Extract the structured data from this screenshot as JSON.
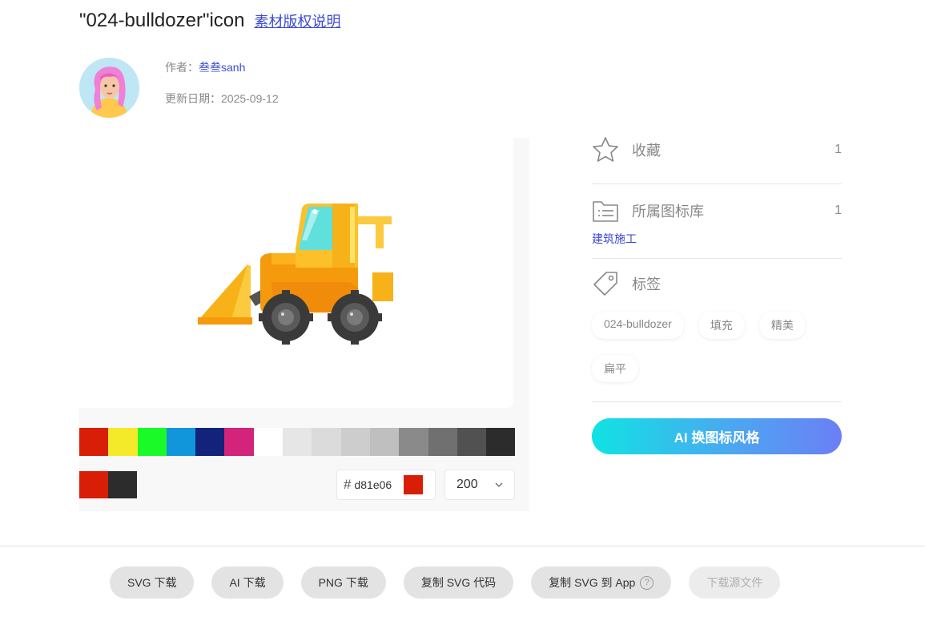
{
  "header": {
    "title": "\"024-bulldozer\"icon",
    "copyright_link": "素材版权说明"
  },
  "author": {
    "label": "作者：",
    "name": "叁叁sanh",
    "updated_label": "更新日期：",
    "updated": "2025-09-12"
  },
  "palette": {
    "colors": [
      "#d81e06",
      "#f4ea2a",
      "#1afa29",
      "#1296db",
      "#13227a",
      "#d4237a",
      "#ffffff",
      "#e6e6e6",
      "#dbdbdb",
      "#cdcdcd",
      "#bfbfbf",
      "#8a8a8a",
      "#707070",
      "#515151",
      "#2c2c2c"
    ],
    "recent": [
      "#d81e06",
      "#2c2c2c"
    ],
    "hash": "#",
    "hex_value": "d81e06",
    "current_color": "#d81e06",
    "size_value": "200"
  },
  "side": {
    "favorite_label": "收藏",
    "favorite_count": "1",
    "library_label": "所属图标库",
    "library_count": "1",
    "library_name": "建筑施工",
    "tags_label": "标签",
    "tags": [
      "024-bulldozer",
      "填充",
      "精美",
      "扁平"
    ],
    "ai_button": "AI 换图标风格"
  },
  "downloads": {
    "svg": "SVG 下载",
    "ai": "AI 下载",
    "png": "PNG 下载",
    "copy_svg": "复制 SVG 代码",
    "copy_svg_app": "复制 SVG 到 App",
    "help": "?",
    "source": "下载源文件"
  }
}
